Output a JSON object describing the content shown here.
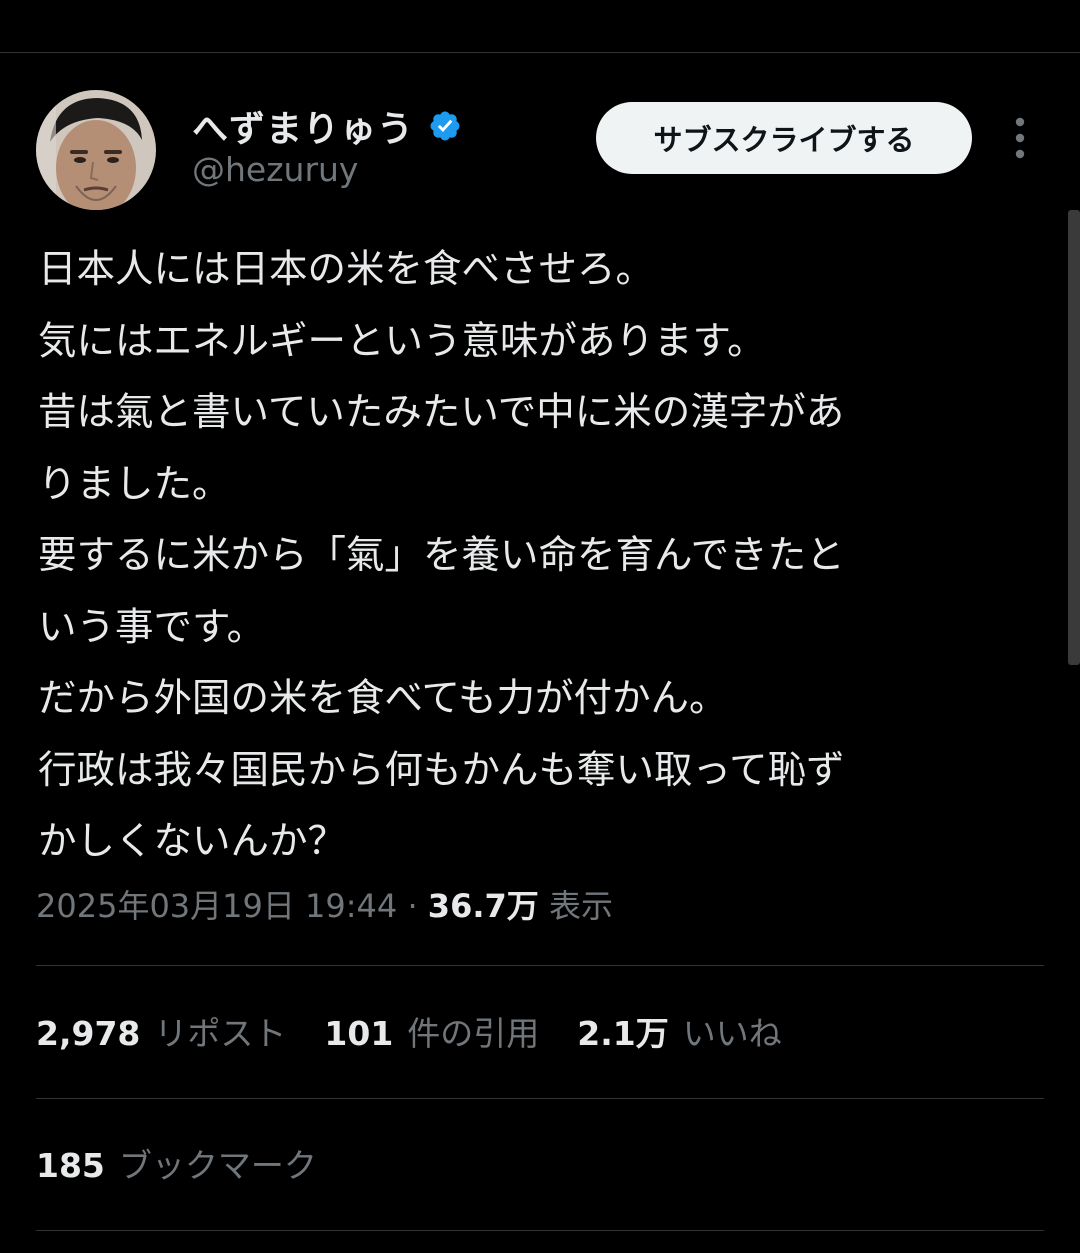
{
  "author": {
    "display_name": "へずまりゅう",
    "handle": "@hezuruy",
    "verified": true,
    "verified_color": "#1d9bf0"
  },
  "header": {
    "subscribe_label": "サブスクライブする",
    "more_icon": "more-vertical-icon"
  },
  "tweet": {
    "lines": [
      "日本人には日本の米を食べさせろ。",
      "気にはエネルギーという意味があります。",
      "昔は氣と書いていたみたいで中に米の漢字があ",
      "りました。",
      "要するに米から「氣」を養い命を育んできたと",
      "いう事です。",
      "だから外国の米を食べても力が付かん。",
      "行政は我々国民から何もかんも奪い取って恥ず",
      "かしくないんか？"
    ],
    "timestamp": "2025年03月19日 19:44",
    "separator": "·",
    "views_count": "36.7万",
    "views_label": "表示"
  },
  "stats": {
    "reposts": {
      "count": "2,978",
      "label": "リポスト"
    },
    "quotes": {
      "count": "101",
      "label": "件の引用"
    },
    "likes": {
      "count": "2.1万",
      "label": "いいね"
    },
    "bookmarks": {
      "count": "185",
      "label": "ブックマーク"
    }
  },
  "colors": {
    "background": "#000000",
    "text_primary": "#e7e9ea",
    "text_secondary": "#71767b",
    "divider": "#2f3336",
    "button_bg": "#eff3f4"
  }
}
